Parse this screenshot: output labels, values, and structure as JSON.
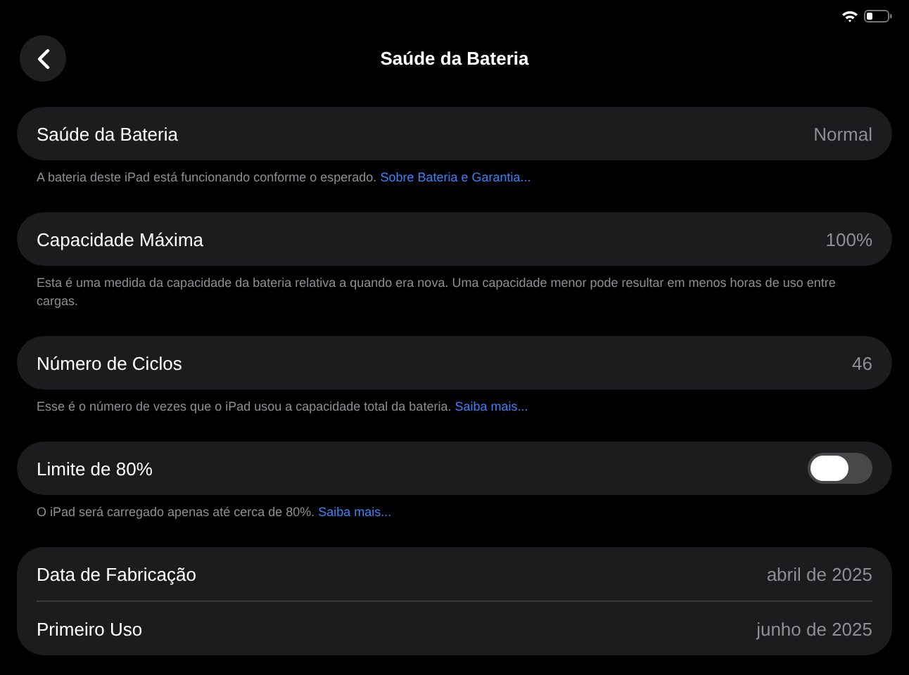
{
  "header": {
    "title": "Saúde da Bateria"
  },
  "groups": [
    {
      "rows": [
        {
          "kind": "value",
          "label": "Saúde da Bateria",
          "value": "Normal"
        }
      ],
      "footer": {
        "text": "A bateria deste iPad está funcionando conforme o esperado.",
        "link": "Sobre Bateria e Garantia..."
      }
    },
    {
      "rows": [
        {
          "kind": "value",
          "label": "Capacidade Máxima",
          "value": "100%"
        }
      ],
      "footer": {
        "text": "Esta é uma medida da capacidade da bateria relativa a quando era nova. Uma capacidade menor pode resultar em menos horas de uso entre cargas."
      }
    },
    {
      "rows": [
        {
          "kind": "value",
          "label": "Número de Ciclos",
          "value": "46"
        }
      ],
      "footer": {
        "text": "Esse é o número de vezes que o iPad usou a capacidade total da bateria.",
        "link": "Saiba mais..."
      }
    },
    {
      "rows": [
        {
          "kind": "toggle",
          "label": "Limite de 80%",
          "on": false
        }
      ],
      "footer": {
        "text": "O iPad será carregado apenas até cerca de 80%.",
        "link": "Saiba mais..."
      }
    },
    {
      "rows": [
        {
          "kind": "value",
          "label": "Data de Fabricação",
          "value": "abril de 2025"
        },
        {
          "kind": "value",
          "label": "Primeiro Uso",
          "value": "junho de 2025"
        }
      ]
    }
  ]
}
